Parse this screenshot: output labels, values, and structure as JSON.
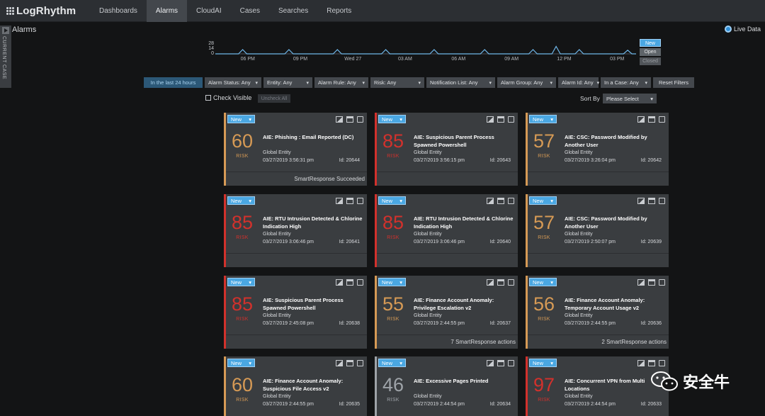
{
  "brand": "LogRhythm",
  "nav": [
    "Dashboards",
    "Alarms",
    "CloudAI",
    "Cases",
    "Searches",
    "Reports"
  ],
  "nav_active": 1,
  "page_title": "Alarms",
  "current_case_label": "CURRENT CASE",
  "live_data_label": "Live Data",
  "timeline": {
    "y_ticks": [
      "28",
      "14",
      "0"
    ],
    "x_ticks": [
      "06 PM",
      "09 PM",
      "Wed 27",
      "03 AM",
      "06 AM",
      "09 AM",
      "12 PM",
      "03 PM"
    ],
    "line_color": "#6fb6e8",
    "points": [
      [
        0,
        0
      ],
      [
        0.055,
        0
      ],
      [
        0.065,
        0.4
      ],
      [
        0.075,
        0
      ],
      [
        0.165,
        0
      ],
      [
        0.175,
        0.4
      ],
      [
        0.185,
        0
      ],
      [
        0.28,
        0
      ],
      [
        0.29,
        0.4
      ],
      [
        0.3,
        0
      ],
      [
        0.395,
        0
      ],
      [
        0.405,
        0.4
      ],
      [
        0.415,
        0
      ],
      [
        0.51,
        0
      ],
      [
        0.52,
        0.4
      ],
      [
        0.53,
        0
      ],
      [
        0.63,
        0
      ],
      [
        0.64,
        0.4
      ],
      [
        0.65,
        0
      ],
      [
        0.745,
        0
      ],
      [
        0.755,
        0.4
      ],
      [
        0.765,
        0
      ],
      [
        0.8,
        0
      ],
      [
        0.81,
        0.7
      ],
      [
        0.82,
        0
      ],
      [
        0.855,
        0
      ],
      [
        0.865,
        0.4
      ],
      [
        0.875,
        0
      ],
      [
        0.97,
        0
      ],
      [
        0.98,
        0.35
      ],
      [
        0.99,
        0
      ],
      [
        1,
        0
      ]
    ]
  },
  "status_toggles": [
    "New",
    "Open",
    "Closed"
  ],
  "filters": [
    {
      "label": "In the last 24 hours",
      "active": true,
      "dropdown": false
    },
    {
      "label": "Alarm Status: Any",
      "active": false,
      "dropdown": true
    },
    {
      "label": "Entity: Any",
      "active": false,
      "dropdown": true
    },
    {
      "label": "Alarm Rule: Any",
      "active": false,
      "dropdown": true
    },
    {
      "label": "Risk: Any",
      "active": false,
      "dropdown": true
    },
    {
      "label": "Notification List: Any",
      "active": false,
      "dropdown": true
    },
    {
      "label": "Alarm Group: Any",
      "active": false,
      "dropdown": true
    },
    {
      "label": "Alarm Id: Any",
      "active": false,
      "dropdown": true
    },
    {
      "label": "In a Case: Any",
      "active": false,
      "dropdown": true
    },
    {
      "label": "Reset Filters",
      "active": false,
      "dropdown": false
    }
  ],
  "check_visible_label": "Check Visible",
  "uncheck_all_label": "Uncheck All",
  "sort_by_label": "Sort By",
  "sort_select_value": "Please Select",
  "risk_label": "RISK",
  "colors": {
    "high": "#d2312c",
    "mid": "#d69a55",
    "low": "#9ea3a8"
  },
  "cards": [
    {
      "status": "New",
      "score": "60",
      "level": "mid",
      "title": "AIE: Phishing : Email Reported (DC)",
      "entity": "Global Entity",
      "date": "03/27/2019 3:56:31 pm",
      "id": "Id: 20644",
      "footer": "SmartResponse Succeeded",
      "footer_dim": false
    },
    {
      "status": "New",
      "score": "85",
      "level": "high",
      "title": "AIE: Suspicious Parent Process Spawned Powershell",
      "entity": "Global Entity",
      "date": "03/27/2019 3:56:15 pm",
      "id": "Id: 20643",
      "footer": "",
      "footer_dim": true
    },
    {
      "status": "New",
      "score": "57",
      "level": "mid",
      "title": "AIE: CSC: Password Modified by Another User",
      "entity": "Global Entity",
      "date": "03/27/2019 3:26:04 pm",
      "id": "Id: 20642",
      "footer": "",
      "footer_dim": true
    },
    {
      "status": "New",
      "score": "85",
      "level": "high",
      "title": "AIE: RTU Intrusion Detected & Chlorine Indication High",
      "entity": "Global Entity",
      "date": "03/27/2019 3:06:46 pm",
      "id": "Id: 20641",
      "footer": "",
      "footer_dim": true
    },
    {
      "status": "New",
      "score": "85",
      "level": "high",
      "title": "AIE: RTU Intrusion Detected & Chlorine Indication High",
      "entity": "Global Entity",
      "date": "03/27/2019 3:06:46 pm",
      "id": "Id: 20640",
      "footer": "",
      "footer_dim": true
    },
    {
      "status": "New",
      "score": "57",
      "level": "mid",
      "title": "AIE: CSC: Password Modified by Another User",
      "entity": "Global Entity",
      "date": "03/27/2019 2:50:07 pm",
      "id": "Id: 20639",
      "footer": "",
      "footer_dim": true
    },
    {
      "status": "New",
      "score": "85",
      "level": "high",
      "title": "AIE: Suspicious Parent Process Spawned Powershell",
      "entity": "Global Entity",
      "date": "03/27/2019 2:45:08 pm",
      "id": "Id: 20638",
      "footer": "",
      "footer_dim": true
    },
    {
      "status": "New",
      "score": "55",
      "level": "mid",
      "title": "AIE: Finance Account Anomaly: Privilege Escalation v2",
      "entity": "Global Entity",
      "date": "03/27/2019 2:44:55 pm",
      "id": "Id: 20637",
      "footer": "7 SmartResponse actions",
      "footer_dim": false
    },
    {
      "status": "New",
      "score": "56",
      "level": "mid",
      "title": "AIE: Finance Account Anomaly: Temporary Account Usage v2",
      "entity": "Global Entity",
      "date": "03/27/2019 2:44:55 pm",
      "id": "Id: 20636",
      "footer": "2 SmartResponse actions",
      "footer_dim": false
    },
    {
      "status": "New",
      "score": "60",
      "level": "mid",
      "title": "AIE: Finance Account Anomaly: Suspicious File Access v2",
      "entity": "Global Entity",
      "date": "03/27/2019 2:44:55 pm",
      "id": "Id: 20635",
      "footer": "",
      "footer_dim": true
    },
    {
      "status": "New",
      "score": "46",
      "level": "low",
      "title": "AIE: Excessive Pages Printed",
      "entity": "Global Entity",
      "date": "03/27/2019 2:44:54 pm",
      "id": "Id: 20634",
      "footer": "",
      "footer_dim": true
    },
    {
      "status": "New",
      "score": "97",
      "level": "high",
      "title": "AIE: Concurrent VPN from Multi Locations",
      "entity": "Global Entity",
      "date": "03/27/2019 2:44:54 pm",
      "id": "Id: 20633",
      "footer": "",
      "footer_dim": true
    }
  ],
  "watermark_text": "安全牛"
}
